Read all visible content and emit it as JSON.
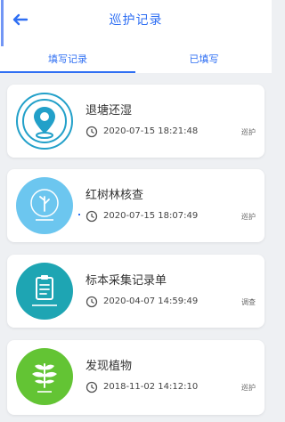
{
  "header": {
    "title": "巡护记录",
    "back_icon": "back-arrow-icon"
  },
  "tabs": [
    {
      "label": "填写记录",
      "active": true
    },
    {
      "label": "已填写",
      "active": false
    }
  ],
  "records": [
    {
      "title": "退塘还湿",
      "time": "2020-07-15 18:21:48",
      "tag": "巡护",
      "icon": "location-pin-icon",
      "color": "#22a0c9"
    },
    {
      "title": "红树林核查",
      "time": "2020-07-15 18:07:49",
      "tag": "巡护",
      "icon": "tree-icon",
      "color": "#6cc6ef"
    },
    {
      "title": "标本采集记录单",
      "time": "2020-04-07 14:59:49",
      "tag": "调查",
      "icon": "clipboard-icon",
      "color": "#1ea5b3"
    },
    {
      "title": "发现植物",
      "time": "2018-11-02 14:12:10",
      "tag": "巡护",
      "icon": "leaf-icon",
      "color": "#63c434"
    }
  ],
  "colors": {
    "accent": "#2f6ff3",
    "background": "#eef0f3"
  }
}
